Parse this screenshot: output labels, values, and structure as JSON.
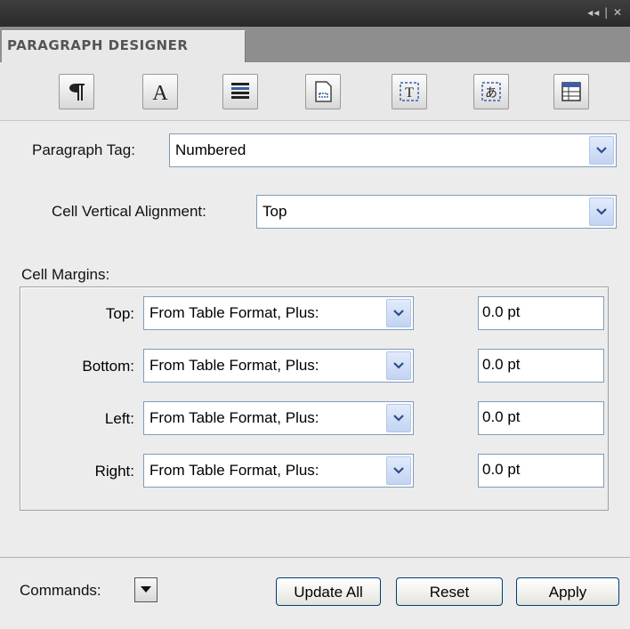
{
  "window": {
    "controls": "◂◂ | ✕"
  },
  "tab": {
    "title": "PARAGRAPH DESIGNER"
  },
  "toolbar": {
    "icons": [
      "pilcrow-icon",
      "font-icon",
      "lines-icon",
      "page-icon",
      "text-frame-icon",
      "asian-text-icon",
      "table-cell-icon"
    ]
  },
  "paragraph_tag": {
    "label": "Paragraph Tag:",
    "value": "Numbered"
  },
  "cell_vertical_alignment": {
    "label": "Cell Vertical Alignment:",
    "value": "Top"
  },
  "cell_margins": {
    "label": "Cell Margins:",
    "rows": [
      {
        "label": "Top:",
        "mode": "From Table Format, Plus:",
        "value": "0.0 pt"
      },
      {
        "label": "Bottom:",
        "mode": "From Table Format, Plus:",
        "value": "0.0 pt"
      },
      {
        "label": "Left:",
        "mode": "From Table Format, Plus:",
        "value": "0.0 pt"
      },
      {
        "label": "Right:",
        "mode": "From Table Format, Plus:",
        "value": "0.0 pt"
      }
    ]
  },
  "footer": {
    "commands_label": "Commands:",
    "update_all": "Update All",
    "reset": "Reset",
    "apply": "Apply"
  }
}
